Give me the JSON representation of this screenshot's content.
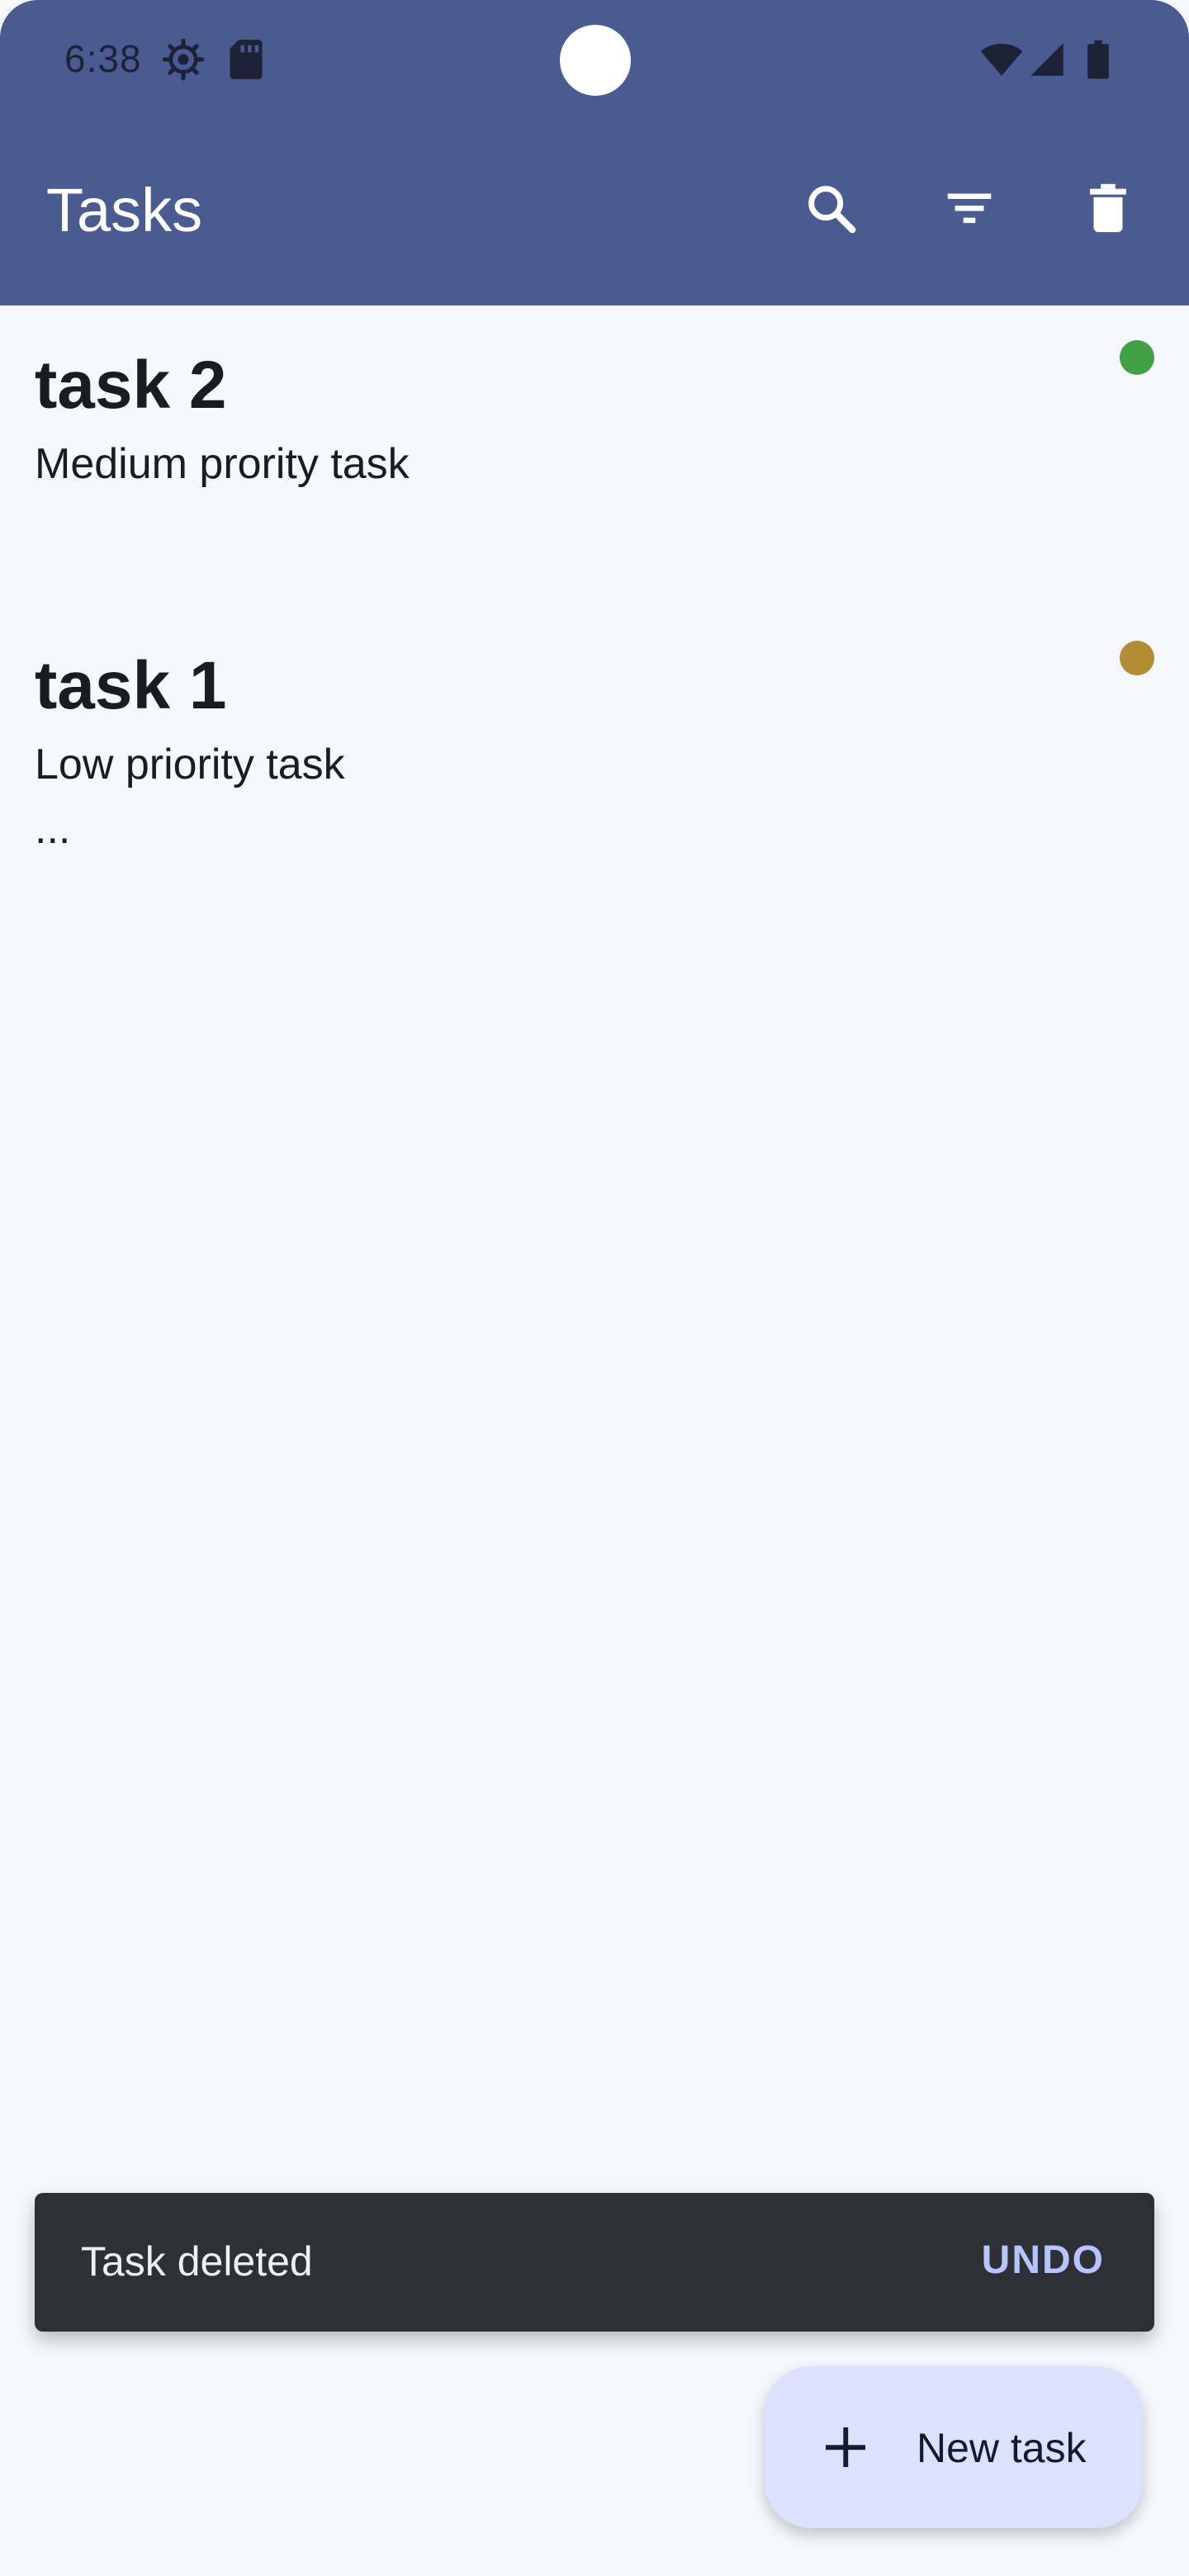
{
  "status_bar": {
    "time": "6:38",
    "icons": [
      "gear-icon",
      "sd-card-icon",
      "wifi-icon",
      "cell-signal-icon",
      "battery-icon"
    ]
  },
  "toolbar": {
    "title": "Tasks",
    "actions": [
      "search-icon",
      "filter-icon",
      "delete-all-icon"
    ]
  },
  "tasks": [
    {
      "title": "task 2",
      "description": "Medium prority task",
      "more": "",
      "priority_color": "#43a047"
    },
    {
      "title": "task 1",
      "description": "Low priority task",
      "more": "...",
      "priority_color": "#b38d34"
    }
  ],
  "snackbar": {
    "message": "Task deleted",
    "action": "UNDO"
  },
  "fab": {
    "label": "New task",
    "icon": "plus-icon"
  },
  "colors": {
    "appbar": "#4a5b91",
    "background": "#f6f8fd",
    "snackbar": "#2e3036",
    "snackbar_action": "#b6c4ff",
    "fab": "#dce2fb"
  }
}
